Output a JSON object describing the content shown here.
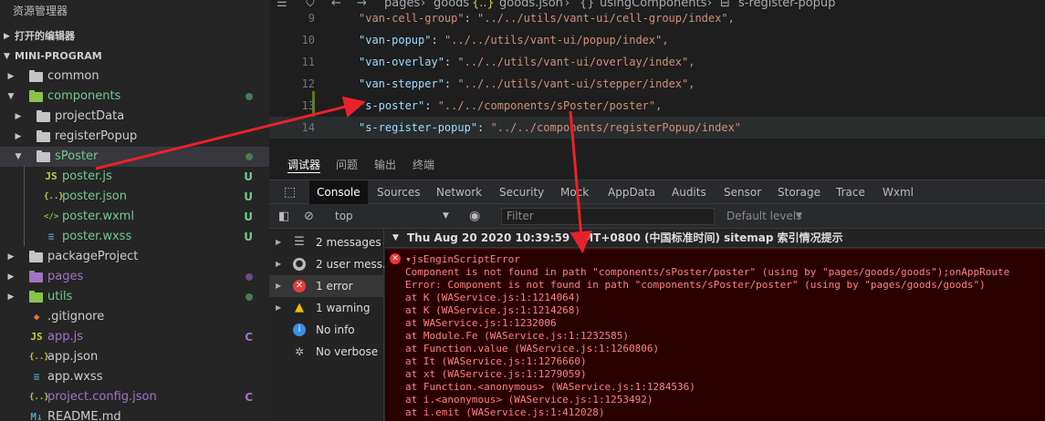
{
  "explorer": {
    "title": "资源管理器",
    "open_editors": "打开的编辑器",
    "project": "MINI-PROGRAM",
    "items": [
      {
        "label": "common",
        "kind": "folder",
        "color": "#c5c5c5",
        "badge": ""
      },
      {
        "label": "components",
        "kind": "folder-open",
        "color": "#8bc34a",
        "badge": "dot-green"
      },
      {
        "label": "projectData",
        "kind": "folder",
        "color": "#c5c5c5",
        "badge": ""
      },
      {
        "label": "registerPopup",
        "kind": "folder",
        "color": "#c5c5c5",
        "badge": ""
      },
      {
        "label": "sPoster",
        "kind": "folder-open",
        "color": "#c5c5c5",
        "badge": "dot-green"
      },
      {
        "label": "poster.js",
        "kind": "file-js",
        "color": "#cbcb41",
        "badge": "U"
      },
      {
        "label": "poster.json",
        "kind": "file-json",
        "color": "#cbcb41",
        "badge": "U"
      },
      {
        "label": "poster.wxml",
        "kind": "file-wxml",
        "color": "#8bc34a",
        "badge": "U"
      },
      {
        "label": "poster.wxss",
        "kind": "file-wxss",
        "color": "#519aba",
        "badge": "U"
      },
      {
        "label": "packageProject",
        "kind": "folder",
        "color": "#c5c5c5",
        "badge": ""
      },
      {
        "label": "pages",
        "kind": "folder",
        "color": "#a074c4",
        "badge": "dot-purple"
      },
      {
        "label": "utils",
        "kind": "folder",
        "color": "#8bc34a",
        "badge": "dot-green"
      },
      {
        "label": ".gitignore",
        "kind": "file-git",
        "color": "#e37933",
        "badge": ""
      },
      {
        "label": "app.js",
        "kind": "file-js",
        "color": "#cbcb41",
        "badge": "C"
      },
      {
        "label": "app.json",
        "kind": "file-json",
        "color": "#cbcb41",
        "badge": ""
      },
      {
        "label": "app.wxss",
        "kind": "file-wxss",
        "color": "#519aba",
        "badge": ""
      },
      {
        "label": "project.config.json",
        "kind": "file-json",
        "color": "#cbcb41",
        "badge": "C"
      },
      {
        "label": "README.md",
        "kind": "file-md",
        "color": "#519aba",
        "badge": ""
      }
    ]
  },
  "breadcrumb": [
    "pages",
    "goods",
    "goods.json",
    "usingComponents",
    "s-register-popup"
  ],
  "editor": {
    "lines": [
      {
        "n": "9",
        "key": "\"van-cell-group\"",
        "val": "\"../../utils/vant-ui/cell-group/index\","
      },
      {
        "n": "10",
        "key": "\"van-popup\"",
        "val": "\"../../utils/vant-ui/popup/index\","
      },
      {
        "n": "11",
        "key": "\"van-overlay\"",
        "val": "\"../../utils/vant-ui/overlay/index\","
      },
      {
        "n": "12",
        "key": "\"van-stepper\"",
        "val": "\"../../utils/vant-ui/stepper/index\","
      },
      {
        "n": "13",
        "key": "\"s-poster\"",
        "val": "\"../../components/sPoster/poster\","
      },
      {
        "n": "14",
        "key": "\"s-register-popup\"",
        "val": "\"../../components/registerPopup/index\""
      }
    ]
  },
  "devtools": {
    "top_tabs": [
      "调试器",
      "问题",
      "输出",
      "终端"
    ],
    "panel_tabs": [
      "Console",
      "Sources",
      "Network",
      "Security",
      "Mock",
      "AppData",
      "Audits",
      "Sensor",
      "Storage",
      "Trace",
      "Wxml"
    ],
    "context": "top",
    "filter_placeholder": "Filter",
    "levels": "Default levels",
    "sidebar": [
      {
        "label": "2 messages",
        "icon": "list-icon",
        "color": "#9e9e9e"
      },
      {
        "label": "2 user mess...",
        "icon": "user-icon",
        "color": "#9e9e9e"
      },
      {
        "label": "1 error",
        "icon": "error-icon",
        "color": "#e33e3e"
      },
      {
        "label": "1 warning",
        "icon": "warning-icon",
        "color": "#f0c000"
      },
      {
        "label": "No info",
        "icon": "info-icon",
        "color": "#3a8ee6"
      },
      {
        "label": "No verbose",
        "icon": "bug-icon",
        "color": "#9e9e9e"
      }
    ],
    "group_header": "Thu Aug 20 2020 10:39:59 GMT+0800 (中国标准时间) sitemap 索引情况提示",
    "error_lines": [
      "▾jsEnginScriptError",
      "Component is not found in path \"components/sPoster/poster\" (using by \"pages/goods/goods\");onAppRoute",
      "Error: Component is not found in path \"components/sPoster/poster\" (using by \"pages/goods/goods\")",
      "    at K (WAService.js:1:1214064)",
      "    at K (WAService.js:1:1214268)",
      "    at WAService.js:1:1232006",
      "    at Module.Fe (WAService.js:1:1232585)",
      "    at Function.value (WAService.js:1:1260806)",
      "    at It (WAService.js:1:1276660)",
      "    at xt (WAService.js:1:1279059)",
      "    at Function.<anonymous> (WAService.js:1:1284536)",
      "    at i.<anonymous> (WAService.js:1:1253492)",
      "    at i.emit (WAService.js:1:412028)"
    ]
  },
  "colors": {
    "arrow": "#e8222a",
    "badge_u": "#73c991",
    "badge_c": "#a074c4"
  }
}
